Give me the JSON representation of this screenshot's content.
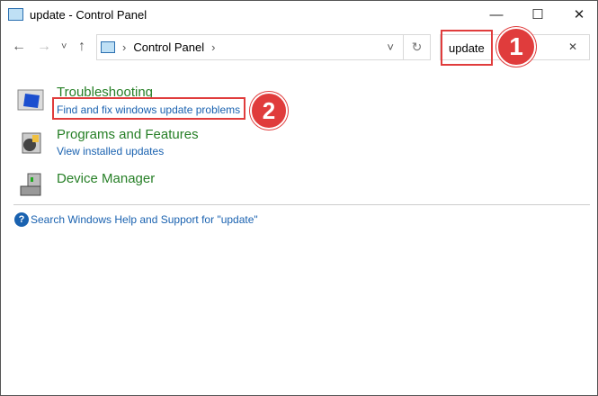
{
  "window": {
    "title": "update - Control Panel",
    "minimize": "—",
    "maximize": "☐",
    "close": "✕"
  },
  "nav": {
    "back": "←",
    "forward": "→",
    "recent": "˅",
    "up": "↑"
  },
  "address": {
    "sep1": "›",
    "location": "Control Panel",
    "sep2": "›",
    "dropdown": "˅",
    "refresh": "↻"
  },
  "search": {
    "value": "update",
    "clear": "✕"
  },
  "annotations": [
    "1",
    "2"
  ],
  "results": [
    {
      "title": "Troubleshooting",
      "link": "Find and fix windows update problems"
    },
    {
      "title": "Programs and Features",
      "link": "View installed updates"
    },
    {
      "title": "Device Manager"
    }
  ],
  "help": {
    "icon": "?",
    "text": "Search Windows Help and Support for \"update\""
  }
}
